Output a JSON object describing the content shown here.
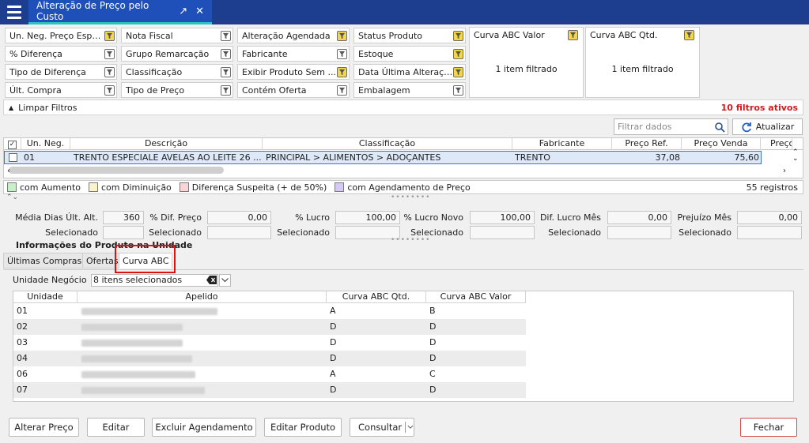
{
  "window": {
    "tab_title": "Alteração de Preço pelo Custo",
    "tab_icons": [
      "expand-icon",
      "close-icon"
    ]
  },
  "filters": {
    "col1": [
      "Un. Neg. Preço Espe...",
      "% Diferença",
      "Tipo de Diferença",
      "Últ. Compra"
    ],
    "col2": [
      "Nota Fiscal",
      "Grupo Remarcação",
      "Classificação",
      "Tipo de Preço"
    ],
    "col3": [
      "Alteração Agendada",
      "Fabricante",
      "Exibir Produto Sem ...",
      "Contém Oferta"
    ],
    "col4": [
      "Status Produto",
      "Estoque",
      "Data Última Alteraçã...",
      "Embalagem"
    ],
    "curva_valor": {
      "title": "Curva ABC Valor",
      "value": "1 item filtrado"
    },
    "curva_qtd": {
      "title": "Curva ABC Qtd.",
      "value": "1 item filtrado"
    }
  },
  "filter_bar": {
    "clear_label": "Limpar Filtros",
    "active_label": "10 filtros ativos"
  },
  "search": {
    "placeholder": "Filtrar dados"
  },
  "refresh_label": "Atualizar",
  "grid": {
    "headers": [
      "Un. Neg.",
      "Descrição",
      "Classificação",
      "Fabricante",
      "Preço Ref.",
      "Preço Venda",
      "Preço"
    ],
    "row": {
      "un_neg": "01",
      "descricao": "TRENTO ESPECIALE AVELAS AO LEITE 26 ...",
      "classificacao": "PRINCIPAL > ALIMENTOS > ADOÇANTES",
      "fabricante": "TRENTO",
      "preco_ref": "37,08",
      "preco_venda": "75,60"
    }
  },
  "legend": {
    "items": [
      {
        "label": "com Aumento",
        "color": "#c8f0c8"
      },
      {
        "label": "com Diminuição",
        "color": "#fbf3c9"
      },
      {
        "label": "Diferença Suspeita (+ de 50%)",
        "color": "#f9d5d5"
      },
      {
        "label": "com Agendamento de Preço",
        "color": "#d7c9f5"
      }
    ],
    "count": "55 registros"
  },
  "stats": {
    "row1": [
      {
        "label": "Média Dias Últ. Alt.",
        "value": "360"
      },
      {
        "label": "% Dif. Preço",
        "value": "0,00"
      },
      {
        "label": "% Lucro",
        "value": "100,00"
      },
      {
        "label": "% Lucro Novo",
        "value": "100,00"
      },
      {
        "label": "Dif. Lucro Mês",
        "value": "0,00"
      },
      {
        "label": "Prejuízo Mês",
        "value": "0,00"
      }
    ],
    "selected_label": "Selecionado"
  },
  "info": {
    "title": "Informações do Produto na Unidade",
    "tabs": [
      "Últimas Compras",
      "Ofertas",
      "Curva ABC"
    ],
    "unidade_label": "Unidade Negócio",
    "unidade_value": "8 itens selecionados"
  },
  "abc_table": {
    "headers": [
      "Unidade",
      "Apelido",
      "Curva ABC Qtd.",
      "Curva ABC Valor"
    ],
    "rows": [
      {
        "unidade": "01",
        "qtd": "A",
        "valor": "B"
      },
      {
        "unidade": "02",
        "qtd": "D",
        "valor": "D"
      },
      {
        "unidade": "03",
        "qtd": "D",
        "valor": "D"
      },
      {
        "unidade": "04",
        "qtd": "D",
        "valor": "D"
      },
      {
        "unidade": "06",
        "qtd": "A",
        "valor": "C"
      },
      {
        "unidade": "07",
        "qtd": "D",
        "valor": "D"
      }
    ]
  },
  "buttons": {
    "alterar": "Alterar Preço",
    "editar": "Editar",
    "excluir": "Excluir Agendamento",
    "editar_produto": "Editar Produto",
    "consultar": "Consultar",
    "fechar": "Fechar"
  }
}
